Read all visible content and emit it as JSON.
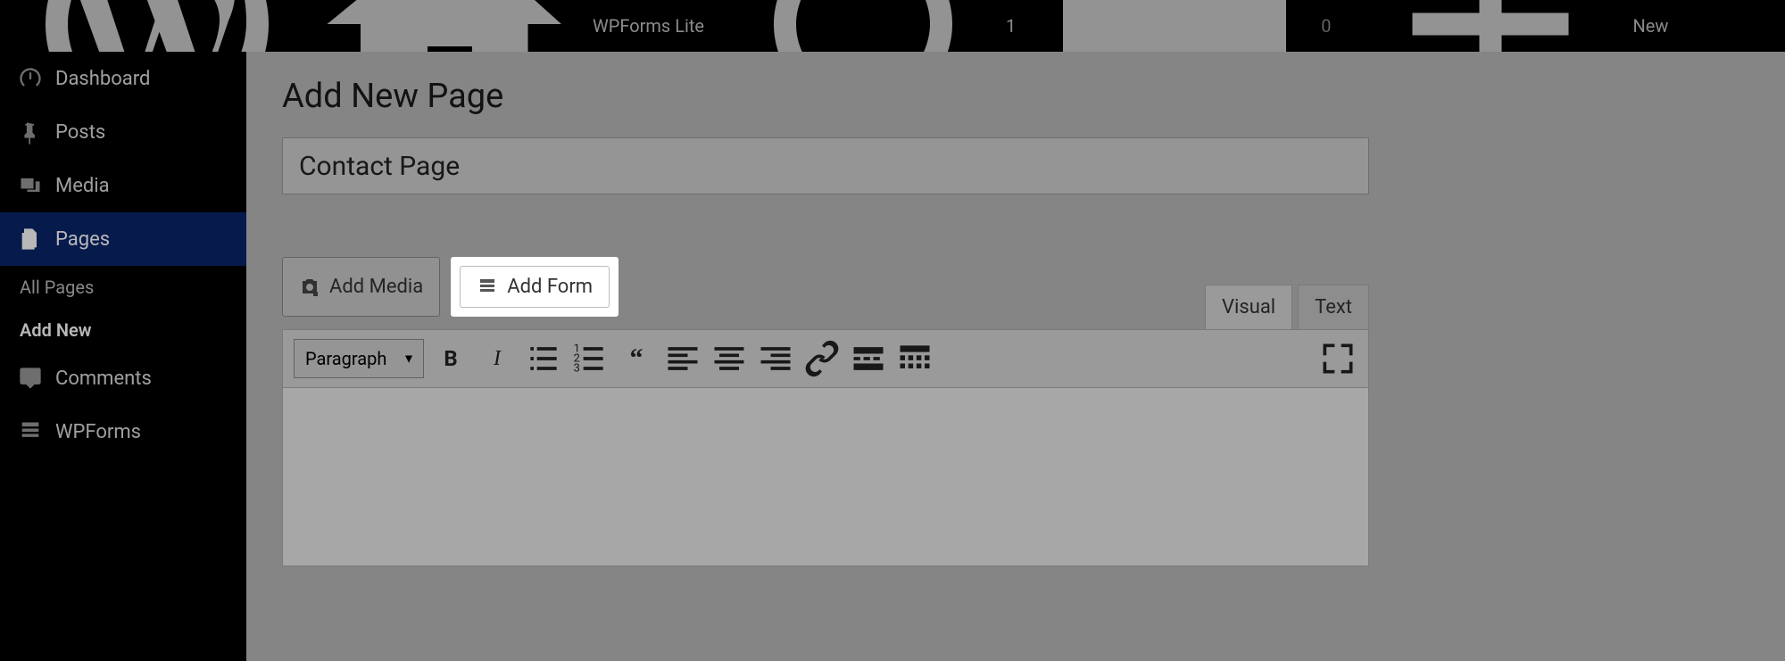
{
  "adminbar": {
    "site_title": "WPForms Lite",
    "updates_count": "1",
    "comments_count": "0",
    "new_label": "New"
  },
  "sidebar": {
    "items": [
      {
        "label": "Dashboard",
        "name": "dashboard"
      },
      {
        "label": "Posts",
        "name": "posts"
      },
      {
        "label": "Media",
        "name": "media"
      },
      {
        "label": "Pages",
        "name": "pages"
      },
      {
        "label": "Comments",
        "name": "comments"
      },
      {
        "label": "WPForms",
        "name": "wpforms"
      }
    ],
    "submenu": {
      "all_pages": "All Pages",
      "add_new": "Add New"
    }
  },
  "page": {
    "heading": "Add New Page",
    "title_value": "Contact Page"
  },
  "editor": {
    "add_media": "Add Media",
    "add_form": "Add Form",
    "tab_visual": "Visual",
    "tab_text": "Text",
    "format_select": "Paragraph"
  }
}
